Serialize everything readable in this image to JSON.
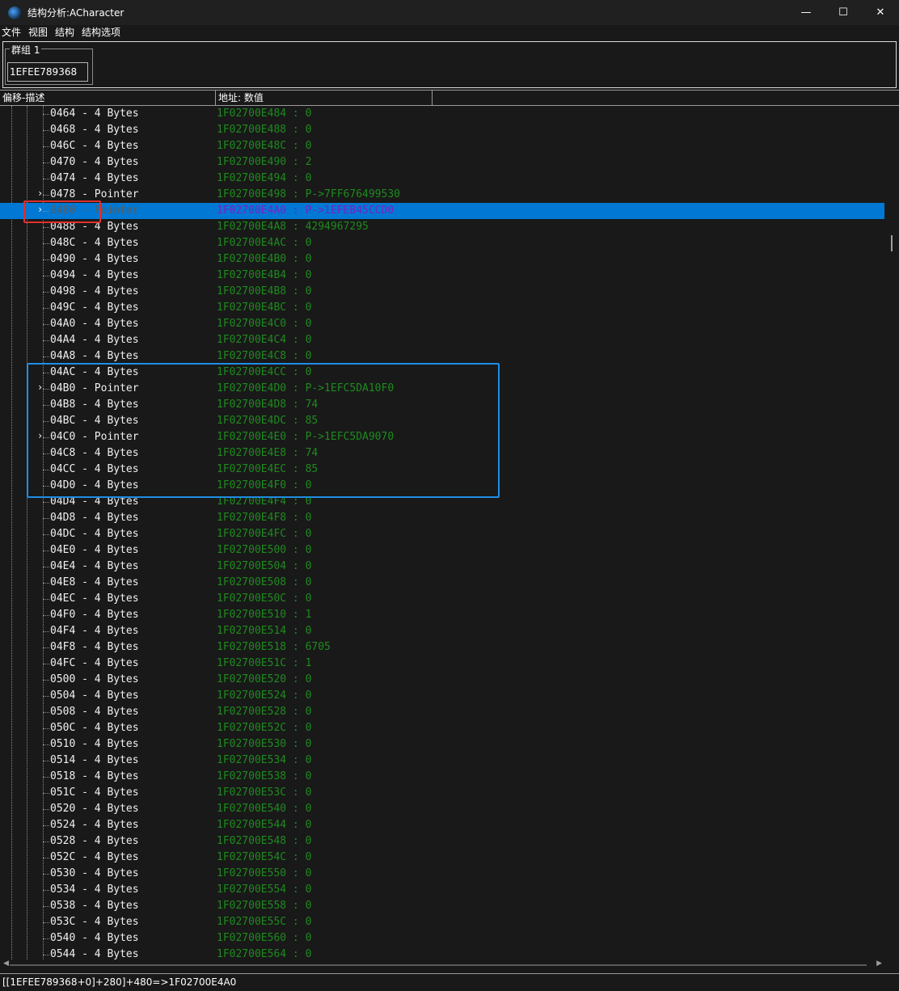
{
  "window": {
    "title": "结构分析:ACharacter",
    "minimize_glyph": "—",
    "maximize_glyph": "☐",
    "close_glyph": "✕",
    "icon": "app-logo-icon"
  },
  "menu": [
    "文件",
    "视图",
    "结构",
    "结构选项"
  ],
  "group": {
    "label": "群组 1",
    "address": "1EFEE789368"
  },
  "columns": {
    "offset_desc": "偏移-描述",
    "address_value": "地址: 数值"
  },
  "rows": [
    {
      "offset": "0464",
      "type": "4 Bytes",
      "address": "1F02700E484",
      "value": "0"
    },
    {
      "offset": "0468",
      "type": "4 Bytes",
      "address": "1F02700E488",
      "value": "0"
    },
    {
      "offset": "046C",
      "type": "4 Bytes",
      "address": "1F02700E48C",
      "value": "0"
    },
    {
      "offset": "0470",
      "type": "4 Bytes",
      "address": "1F02700E490",
      "value": "2"
    },
    {
      "offset": "0474",
      "type": "4 Bytes",
      "address": "1F02700E494",
      "value": "0"
    },
    {
      "offset": "0478",
      "type": "Pointer",
      "address": "1F02700E498",
      "value": "P->7FF676499530",
      "expandable": true
    },
    {
      "offset": "0480",
      "type": "Pointer",
      "address": "1F02700E4A0",
      "value": "P->1EFEB45CCD0",
      "expandable": true,
      "selected": true
    },
    {
      "offset": "0488",
      "type": "4 Bytes",
      "address": "1F02700E4A8",
      "value": "4294967295"
    },
    {
      "offset": "048C",
      "type": "4 Bytes",
      "address": "1F02700E4AC",
      "value": "0"
    },
    {
      "offset": "0490",
      "type": "4 Bytes",
      "address": "1F02700E4B0",
      "value": "0"
    },
    {
      "offset": "0494",
      "type": "4 Bytes",
      "address": "1F02700E4B4",
      "value": "0"
    },
    {
      "offset": "0498",
      "type": "4 Bytes",
      "address": "1F02700E4B8",
      "value": "0"
    },
    {
      "offset": "049C",
      "type": "4 Bytes",
      "address": "1F02700E4BC",
      "value": "0"
    },
    {
      "offset": "04A0",
      "type": "4 Bytes",
      "address": "1F02700E4C0",
      "value": "0"
    },
    {
      "offset": "04A4",
      "type": "4 Bytes",
      "address": "1F02700E4C4",
      "value": "0"
    },
    {
      "offset": "04A8",
      "type": "4 Bytes",
      "address": "1F02700E4C8",
      "value": "0"
    },
    {
      "offset": "04AC",
      "type": "4 Bytes",
      "address": "1F02700E4CC",
      "value": "0"
    },
    {
      "offset": "04B0",
      "type": "Pointer",
      "address": "1F02700E4D0",
      "value": "P->1EFC5DA10F0",
      "expandable": true
    },
    {
      "offset": "04B8",
      "type": "4 Bytes",
      "address": "1F02700E4D8",
      "value": "74"
    },
    {
      "offset": "04BC",
      "type": "4 Bytes",
      "address": "1F02700E4DC",
      "value": "85"
    },
    {
      "offset": "04C0",
      "type": "Pointer",
      "address": "1F02700E4E0",
      "value": "P->1EFC5DA9070",
      "expandable": true
    },
    {
      "offset": "04C8",
      "type": "4 Bytes",
      "address": "1F02700E4E8",
      "value": "74"
    },
    {
      "offset": "04CC",
      "type": "4 Bytes",
      "address": "1F02700E4EC",
      "value": "85"
    },
    {
      "offset": "04D0",
      "type": "4 Bytes",
      "address": "1F02700E4F0",
      "value": "0"
    },
    {
      "offset": "04D4",
      "type": "4 Bytes",
      "address": "1F02700E4F4",
      "value": "0"
    },
    {
      "offset": "04D8",
      "type": "4 Bytes",
      "address": "1F02700E4F8",
      "value": "0"
    },
    {
      "offset": "04DC",
      "type": "4 Bytes",
      "address": "1F02700E4FC",
      "value": "0"
    },
    {
      "offset": "04E0",
      "type": "4 Bytes",
      "address": "1F02700E500",
      "value": "0"
    },
    {
      "offset": "04E4",
      "type": "4 Bytes",
      "address": "1F02700E504",
      "value": "0"
    },
    {
      "offset": "04E8",
      "type": "4 Bytes",
      "address": "1F02700E508",
      "value": "0"
    },
    {
      "offset": "04EC",
      "type": "4 Bytes",
      "address": "1F02700E50C",
      "value": "0"
    },
    {
      "offset": "04F0",
      "type": "4 Bytes",
      "address": "1F02700E510",
      "value": "1"
    },
    {
      "offset": "04F4",
      "type": "4 Bytes",
      "address": "1F02700E514",
      "value": "0"
    },
    {
      "offset": "04F8",
      "type": "4 Bytes",
      "address": "1F02700E518",
      "value": "6705"
    },
    {
      "offset": "04FC",
      "type": "4 Bytes",
      "address": "1F02700E51C",
      "value": "1"
    },
    {
      "offset": "0500",
      "type": "4 Bytes",
      "address": "1F02700E520",
      "value": "0"
    },
    {
      "offset": "0504",
      "type": "4 Bytes",
      "address": "1F02700E524",
      "value": "0"
    },
    {
      "offset": "0508",
      "type": "4 Bytes",
      "address": "1F02700E528",
      "value": "0"
    },
    {
      "offset": "050C",
      "type": "4 Bytes",
      "address": "1F02700E52C",
      "value": "0"
    },
    {
      "offset": "0510",
      "type": "4 Bytes",
      "address": "1F02700E530",
      "value": "0"
    },
    {
      "offset": "0514",
      "type": "4 Bytes",
      "address": "1F02700E534",
      "value": "0"
    },
    {
      "offset": "0518",
      "type": "4 Bytes",
      "address": "1F02700E538",
      "value": "0"
    },
    {
      "offset": "051C",
      "type": "4 Bytes",
      "address": "1F02700E53C",
      "value": "0"
    },
    {
      "offset": "0520",
      "type": "4 Bytes",
      "address": "1F02700E540",
      "value": "0"
    },
    {
      "offset": "0524",
      "type": "4 Bytes",
      "address": "1F02700E544",
      "value": "0"
    },
    {
      "offset": "0528",
      "type": "4 Bytes",
      "address": "1F02700E548",
      "value": "0"
    },
    {
      "offset": "052C",
      "type": "4 Bytes",
      "address": "1F02700E54C",
      "value": "0"
    },
    {
      "offset": "0530",
      "type": "4 Bytes",
      "address": "1F02700E550",
      "value": "0"
    },
    {
      "offset": "0534",
      "type": "4 Bytes",
      "address": "1F02700E554",
      "value": "0"
    },
    {
      "offset": "0538",
      "type": "4 Bytes",
      "address": "1F02700E558",
      "value": "0"
    },
    {
      "offset": "053C",
      "type": "4 Bytes",
      "address": "1F02700E55C",
      "value": "0"
    },
    {
      "offset": "0540",
      "type": "4 Bytes",
      "address": "1F02700E560",
      "value": "0"
    },
    {
      "offset": "0544",
      "type": "4 Bytes",
      "address": "1F02700E564",
      "value": "0"
    }
  ],
  "status": "[[1EFEE789368+0]+280]+480=>1F02700E4A0",
  "colors": {
    "selection": "#0078d4",
    "value_text": "#1f8a1f",
    "highlight_red": "#e0302c",
    "highlight_blue": "#1e8ee6"
  }
}
